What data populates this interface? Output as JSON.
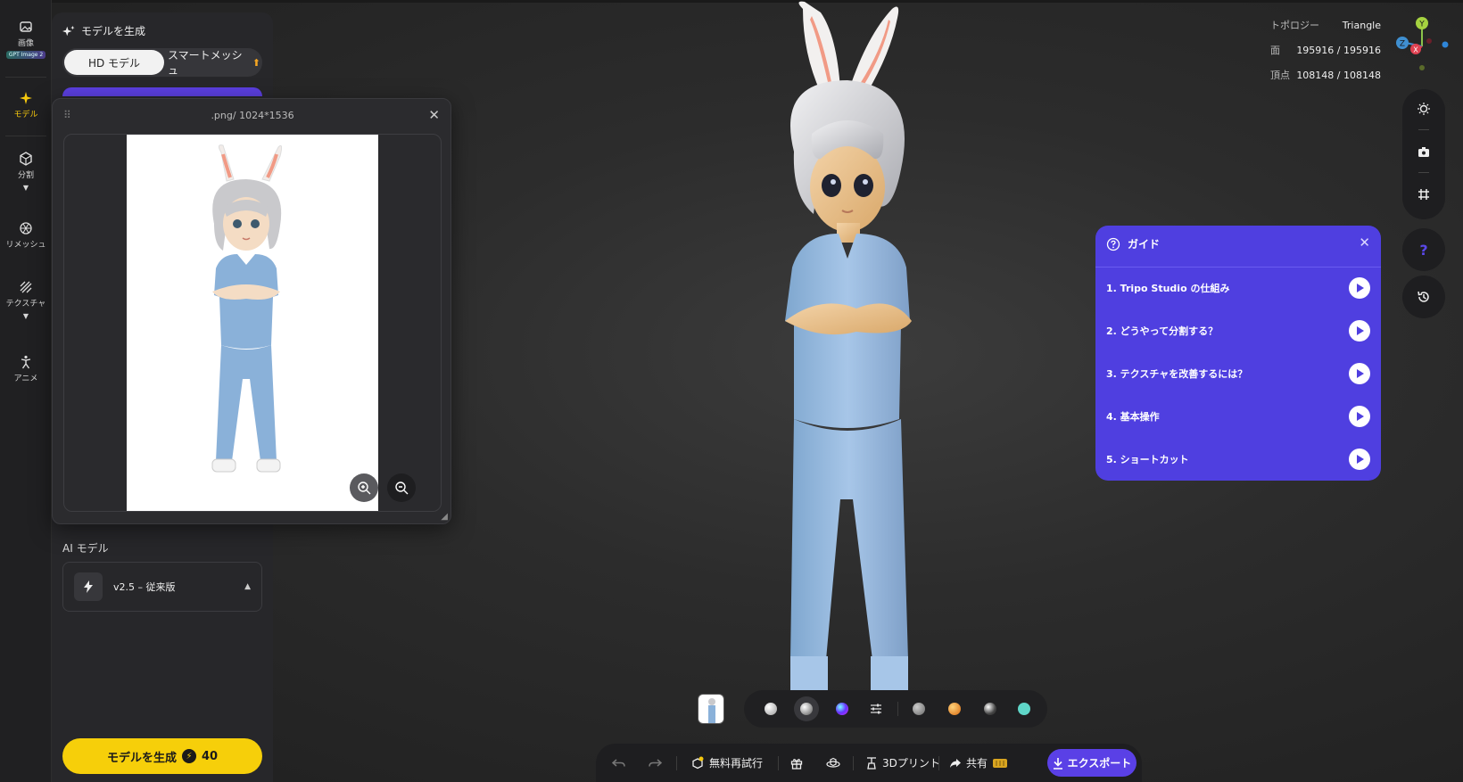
{
  "rail": {
    "items": [
      {
        "label": "画像",
        "badge": "GPT Image 2"
      },
      {
        "label": "モデル"
      },
      {
        "label": "分割"
      },
      {
        "label": "リメッシュ"
      },
      {
        "label": "テクスチャ"
      },
      {
        "label": "アニメ"
      }
    ],
    "active_color": "#f6c90e"
  },
  "panel": {
    "title": "モデルを生成",
    "tab_hd": "HD モデル",
    "tab_smart": "スマートメッシュ",
    "ai_label": "AI モデル",
    "ai_model": "v2.5 – 従来版",
    "generate_label": "モデルを生成",
    "generate_cost": "40",
    "generate_color": "#f6cf0a"
  },
  "popup": {
    "title": ".png/ 1024*1536"
  },
  "stats": {
    "topology_label": "トポロジー",
    "topology_value": "Triangle",
    "faces_label": "面",
    "faces_value": "195916 / 195916",
    "verts_label": "頂点",
    "verts_value": "108148 / 108148"
  },
  "gizmo": {
    "y": "Y",
    "z": "Z",
    "x": "X"
  },
  "guide": {
    "title": "ガイド",
    "color": "#4f3fe0",
    "items": [
      "1. Tripo Studio の仕組み",
      "2. どうやって分割する？",
      "3. テクスチャを改善するには？",
      "4. 基本操作",
      "5. ショートカット"
    ]
  },
  "toolbar": {
    "retry": "無料再試行",
    "print": "3Dプリント",
    "share": "共有",
    "export": "エクスポート",
    "export_color": "#5a40e6"
  }
}
